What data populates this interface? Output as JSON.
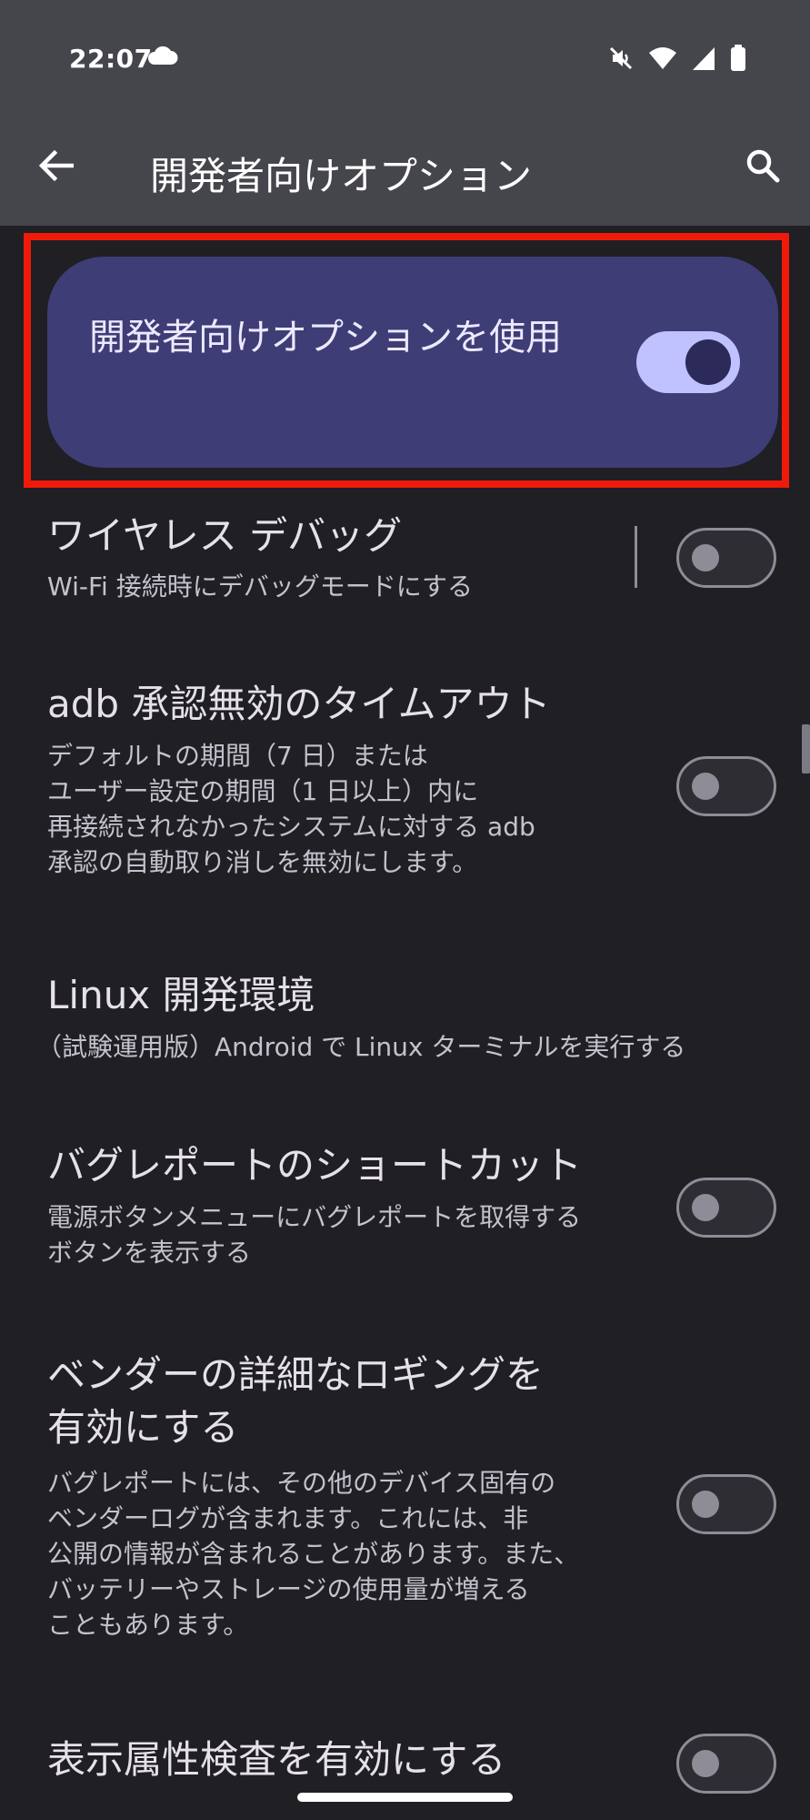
{
  "status_bar": {
    "time": "22:07",
    "icons": [
      "cloud-icon",
      "mute-icon",
      "wifi-icon",
      "cell-signal-icon",
      "battery-icon"
    ]
  },
  "app_bar": {
    "title": "開発者向けオプション",
    "back_icon": "arrow-back-icon",
    "search_icon": "search-icon"
  },
  "master_switch": {
    "label": "開発者向けオプションを使用",
    "enabled": true,
    "highlight_color": "#f01a0a"
  },
  "settings": [
    {
      "title": "ワイヤレス デバッグ",
      "summary": [
        "Wi-Fi 接続時にデバッグモードにする"
      ],
      "toggle": false
    },
    {
      "title": "adb 承認無効のタイムアウト",
      "summary": [
        "デフォルトの期間（7 日）または",
        "ユーザー設定の期間（1 日以上）内に",
        "再接続されなかったシステムに対する adb",
        "承認の自動取り消しを無効にします。"
      ],
      "toggle": false
    },
    {
      "title": "Linux 開発環境",
      "summary": [
        "（試験運用版）Android で Linux ターミナルを実行する"
      ]
    },
    {
      "title": "バグレポートのショートカット",
      "summary": [
        "電源ボタンメニューにバグレポートを取得する",
        "ボタンを表示する"
      ],
      "toggle": false
    },
    {
      "title_lines": [
        "ベンダーの詳細なロギングを",
        "有効にする"
      ],
      "summary": [
        "バグレポートには、その他のデバイス固有の",
        "ベンダーログが含まれます。これには、非",
        "公開の情報が含まれることがあります。また、",
        "バッテリーやストレージの使用量が増える",
        "こともあります。"
      ],
      "toggle": false
    },
    {
      "title": "表示属性検査を有効にする",
      "toggle": false
    }
  ],
  "colors": {
    "background": "#1f1f24",
    "header": "#45454c",
    "card": "#3f3d76",
    "toggle_on_track": "#c0c1ff"
  }
}
